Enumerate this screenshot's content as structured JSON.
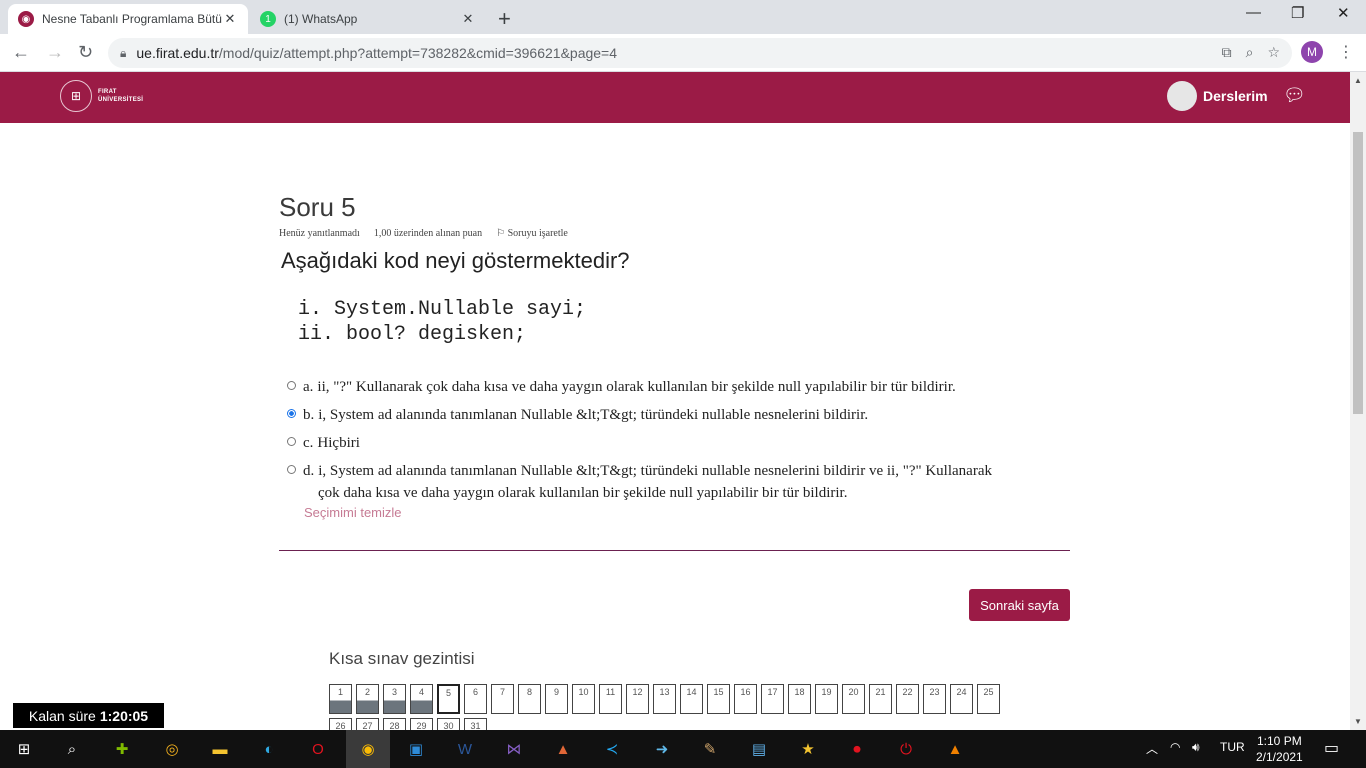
{
  "browser": {
    "tabs": [
      {
        "title": "Nesne Tabanlı Programlama Bütü",
        "favicon": "moodle-icon"
      },
      {
        "title": "(1) WhatsApp",
        "favicon": "whatsapp-icon",
        "badge": "1"
      }
    ],
    "url_host": "ue.firat.edu.tr",
    "url_path": "/mod/quiz/attempt.php?attempt=738282&cmid=396621&page=4",
    "profile_initial": "M"
  },
  "site": {
    "logo_line1": "FIRAT",
    "logo_line2": "ÜNİVERSİTESİ",
    "user_menu_label": "Derslerim",
    "brand_color": "#9b1b46"
  },
  "question": {
    "number_label": "Soru 5",
    "state": "Henüz yanıtlanmadı",
    "marks": "1,00 üzerinden alınan puan",
    "flag_label": "Soruyu işaretle",
    "text": "Aşağıdaki kod neyi göstermektedir?",
    "code_line1": "i. System.Nullable sayi;",
    "code_line2": "ii. bool? degisken;",
    "answers": [
      {
        "letter": "a.",
        "text": "ii, \"?\" Kullanarak çok daha kısa ve daha yaygın olarak kullanılan bir şekilde null yapılabilir bir tür bildirir.",
        "checked": false
      },
      {
        "letter": "b.",
        "text": "i, System ad alanında tanımlanan Nullable &lt;T&gt; türündeki nullable nesnelerini bildirir.",
        "checked": true
      },
      {
        "letter": "c.",
        "text": "Hiçbiri",
        "checked": false
      },
      {
        "letter": "d.",
        "text_line1": "i, System ad alanında tanımlanan Nullable &lt;T&gt; türündeki nullable nesnelerini bildirir ve ii, \"?\" Kullanarak",
        "text_line2": "çok daha kısa ve daha yaygın olarak kullanılan bir şekilde null yapılabilir bir tür bildirir.",
        "checked": false
      }
    ],
    "clear_label": "Seçimimi temizle",
    "next_label": "Sonraki sayfa"
  },
  "quiz_nav": {
    "title": "Kısa sınav gezintisi",
    "row1": [
      "1",
      "2",
      "3",
      "4",
      "5",
      "6",
      "7",
      "8",
      "9",
      "10",
      "11",
      "12",
      "13",
      "14",
      "15",
      "16",
      "17",
      "18",
      "19",
      "20",
      "21",
      "22",
      "23",
      "24",
      "25"
    ],
    "row2": [
      "26",
      "27",
      "28",
      "29",
      "30",
      "31"
    ],
    "answered": [
      "1",
      "2",
      "3",
      "4"
    ],
    "current": "5"
  },
  "timer": {
    "label": "Kalan süre",
    "value": "1:20:05"
  },
  "taskbar": {
    "language": "TUR",
    "time": "1:10 PM",
    "date": "2/1/2021"
  }
}
